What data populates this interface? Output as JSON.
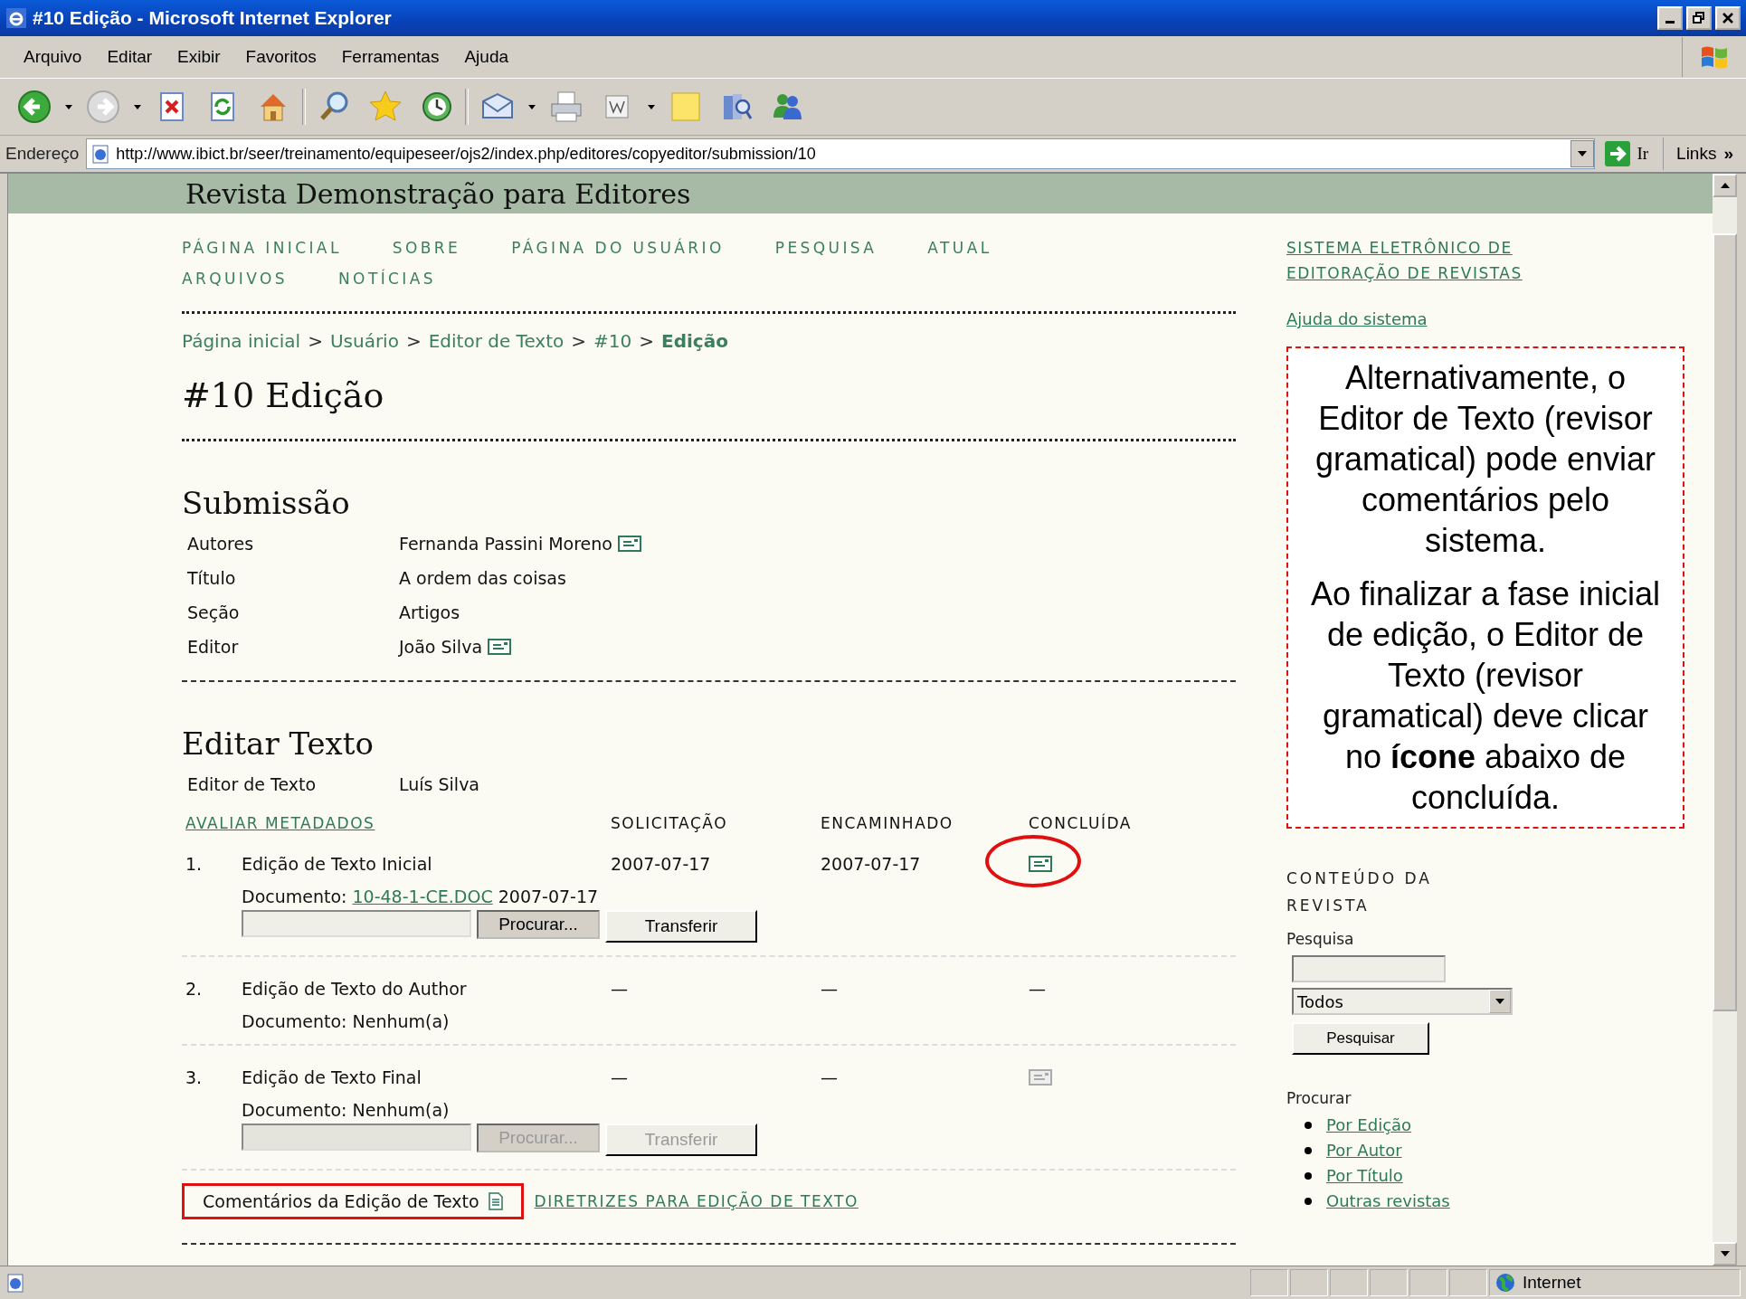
{
  "window": {
    "title": "#10 Edição - Microsoft Internet Explorer"
  },
  "menu": [
    "Arquivo",
    "Editar",
    "Exibir",
    "Favoritos",
    "Ferramentas",
    "Ajuda"
  ],
  "toolbar": [
    {
      "kind": "back"
    },
    {
      "kind": "forward"
    },
    {
      "kind": "stop"
    },
    {
      "kind": "refresh"
    },
    {
      "kind": "home"
    },
    {
      "kind": "search"
    },
    {
      "kind": "favorites"
    },
    {
      "kind": "history"
    },
    {
      "kind": "mail"
    },
    {
      "kind": "print"
    },
    {
      "kind": "edit"
    },
    {
      "kind": "note"
    },
    {
      "kind": "research"
    },
    {
      "kind": "messenger"
    }
  ],
  "address": {
    "label": "Endereço",
    "url": "http://www.ibict.br/seer/treinamento/equipeseer/ojs2/index.php/editores/copyeditor/submission/10",
    "go": "Ir",
    "links": "Links",
    "more": "»"
  },
  "page": {
    "header_title": "Revista Demonstração para Editores",
    "nav": [
      "PÁGINA INICIAL",
      "SOBRE",
      "PÁGINA DO USUÁRIO",
      "PESQUISA",
      "ATUAL",
      "ARQUIVOS",
      "NOTÍCIAS"
    ],
    "breadcrumb": [
      {
        "label": "Página inicial",
        "current": false
      },
      {
        "label": "Usuário",
        "current": false
      },
      {
        "label": "Editor de Texto",
        "current": false
      },
      {
        "label": "#10",
        "current": false
      },
      {
        "label": "Edição",
        "current": true
      }
    ],
    "breadcrumb_separator": ">",
    "heading": "#10 Edição",
    "submission": {
      "title": "Submissão",
      "fields": [
        {
          "label": "Autores",
          "value": "Fernanda Passini Moreno",
          "email": true
        },
        {
          "label": "Título",
          "value": "A ordem das coisas",
          "email": false
        },
        {
          "label": "Seção",
          "value": "Artigos",
          "email": false
        },
        {
          "label": "Editor",
          "value": "João Silva",
          "email": true
        }
      ]
    },
    "editing": {
      "title": "Editar Texto",
      "editor_label": "Editor de Texto",
      "editor_name": "Luís Silva",
      "metadata_link": "AVALIAR METADADOS",
      "columns": [
        "SOLICITAÇÃO",
        "ENCAMINHADO",
        "CONCLUÍDA"
      ],
      "steps": [
        {
          "number": "1.",
          "name": "Edição de Texto Inicial",
          "requested": "2007-07-17",
          "underway": "2007-07-17",
          "complete": {
            "kind": "icon",
            "disabled": false,
            "highlighted": true
          },
          "document": {
            "label": "Documento:",
            "link": "10-48-1-CE.DOC",
            "date": "2007-07-17"
          },
          "upload": {
            "browse": "Procurar...",
            "submit": "Transferir",
            "disabled": false
          }
        },
        {
          "number": "2.",
          "name": "Edição de Texto do Author",
          "requested": "—",
          "underway": "—",
          "complete": {
            "kind": "text",
            "text": "—"
          },
          "document": {
            "label": "Documento:",
            "value": "Nenhum(a)"
          }
        },
        {
          "number": "3.",
          "name": "Edição de Texto Final",
          "requested": "—",
          "underway": "—",
          "complete": {
            "kind": "icon",
            "disabled": true,
            "highlighted": false
          },
          "document": {
            "label": "Documento:",
            "value": "Nenhum(a)"
          },
          "upload": {
            "browse": "Procurar...",
            "submit": "Transferir",
            "disabled": true
          }
        }
      ],
      "comments": {
        "label": "Comentários da Edição de Texto",
        "highlighted": true
      },
      "guidelines_link": "DIRETRIZES PARA EDIÇÃO DE TEXTO"
    }
  },
  "sidebar": {
    "system_link": "SISTEMA ELETRÔNICO DE EDITORAÇÃO DE REVISTAS",
    "help_link": "Ajuda do sistema",
    "callout": [
      "Alternativamente, o Editor de Texto (revisor gramatical) pode enviar comentários pelo sistema.",
      "Ao finalizar a fase inicial de edição, o Editor de Texto (revisor gramatical) deve clicar no **ícone** abaixo de concluída."
    ],
    "content_title": "CONTEÚDO DA REVISTA",
    "search_label": "Pesquisa",
    "search_scope": "Todos",
    "search_button": "Pesquisar",
    "browse_title": "Procurar",
    "browse_links": [
      "Por Edição",
      "Por Autor",
      "Por Título",
      "Outras revistas"
    ]
  },
  "status_bar": {
    "zone": "Internet"
  }
}
